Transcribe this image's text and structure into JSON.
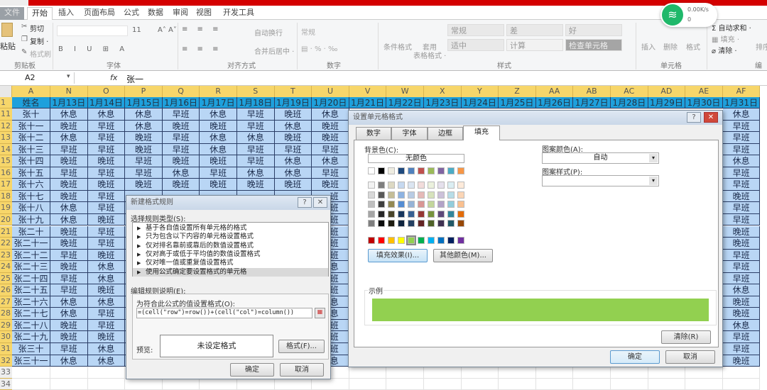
{
  "ribbon": {
    "tabs": [
      "文件",
      "开始",
      "插入",
      "页面布局",
      "公式",
      "数据",
      "审阅",
      "视图",
      "开发工具"
    ],
    "clipboard": {
      "paste": "粘贴",
      "cut": "剪切",
      "copy": "复制 ·",
      "format_painter": "格式刷",
      "group": "剪贴板"
    },
    "font": {
      "size": "11",
      "group": "字体"
    },
    "alignment": {
      "wrap": "自动换行",
      "merge": "合并后居中 ·",
      "group": "对齐方式"
    },
    "number": {
      "format": "常规",
      "group": "数字"
    },
    "styles": {
      "conditional": "条件格式",
      "table1": "套用",
      "table2": "表格格式 ·",
      "boxes": [
        "常规",
        "差",
        "好",
        "适中",
        "计算",
        "检查单元格"
      ],
      "group": "样式"
    },
    "cells": {
      "insert": "插入",
      "delete": "删除",
      "format": "格式",
      "group": "单元格"
    },
    "editing": {
      "autosum": "自动求和 ·",
      "fill": "填充 ·",
      "clear": "清除 ·",
      "sort": "排序",
      "group": "编"
    }
  },
  "network_widget": {
    "speed": "0.00K/s",
    "count": "0",
    "icon": "wifi-icon"
  },
  "formula_bar": {
    "name_box": "A2",
    "fx": "fx",
    "value": "张一"
  },
  "sheet": {
    "columns": [
      "A",
      "N",
      "O",
      "P",
      "Q",
      "R",
      "S",
      "T",
      "U",
      "V",
      "W",
      "X",
      "Y",
      "Z",
      "AA",
      "AB",
      "AC",
      "AD",
      "AE",
      "AF"
    ],
    "header_row": {
      "num": "1",
      "values": [
        "姓名",
        "1月13日",
        "1月14日",
        "1月15日",
        "1月16日",
        "1月17日",
        "1月18日",
        "1月19日",
        "1月20日",
        "1月21日",
        "1月22日",
        "1月23日",
        "1月24日",
        "1月25日",
        "1月26日",
        "1月27日",
        "1月28日",
        "1月29日",
        "1月30日",
        "1月31日"
      ]
    },
    "rows": [
      {
        "num": "11",
        "A": "张十",
        "N": "休息",
        "O": "休息",
        "P": "休息",
        "Q": "早班",
        "R": "休息",
        "S": "早班",
        "T": "晚班",
        "U": "休息",
        "AF": "休息"
      },
      {
        "num": "12",
        "A": "张十一",
        "N": "晚班",
        "O": "早班",
        "P": "休息",
        "Q": "晚班",
        "R": "晚班",
        "S": "早班",
        "T": "休息",
        "U": "晚班",
        "AF": "早班"
      },
      {
        "num": "13",
        "A": "张十二",
        "N": "休息",
        "O": "早班",
        "P": "晚班",
        "Q": "早班",
        "R": "休息",
        "S": "休息",
        "T": "晚班",
        "U": "晚班",
        "AF": "早班"
      },
      {
        "num": "14",
        "A": "张十三",
        "N": "早班",
        "O": "早班",
        "P": "晚班",
        "Q": "早班",
        "R": "休息",
        "S": "早班",
        "T": "早班",
        "U": "早班",
        "AF": "早班"
      },
      {
        "num": "15",
        "A": "张十四",
        "N": "晚班",
        "O": "晚班",
        "P": "早班",
        "Q": "晚班",
        "R": "晚班",
        "S": "早班",
        "T": "休息",
        "U": "休息",
        "AF": "休息"
      },
      {
        "num": "16",
        "A": "张十五",
        "N": "早班",
        "O": "早班",
        "P": "早班",
        "Q": "休息",
        "R": "早班",
        "S": "休息",
        "T": "休息",
        "U": "早班",
        "AF": "早班"
      },
      {
        "num": "17",
        "A": "张十六",
        "N": "晚班",
        "O": "晚班",
        "P": "晚班",
        "Q": "晚班",
        "R": "晚班",
        "S": "晚班",
        "T": "晚班",
        "U": "晚班",
        "AF": "早班"
      },
      {
        "num": "18",
        "A": "张十七",
        "N": "晚班",
        "O": "早班",
        "U": "班",
        "AF": "晚班"
      },
      {
        "num": "19",
        "A": "张十八",
        "N": "休息",
        "O": "早班",
        "U": "班",
        "AF": "早班"
      },
      {
        "num": "20",
        "A": "张十九",
        "N": "休息",
        "O": "晚班",
        "U": "班",
        "AF": "早班"
      },
      {
        "num": "21",
        "A": "张二十",
        "N": "晚班",
        "O": "早班",
        "U": "班",
        "AF": "晚班"
      },
      {
        "num": "22",
        "A": "张二十一",
        "N": "晚班",
        "O": "早班",
        "U": "班",
        "AF": "晚班"
      },
      {
        "num": "23",
        "A": "张二十二",
        "N": "早班",
        "O": "晚班",
        "U": "班",
        "AF": "早班"
      },
      {
        "num": "24",
        "A": "张二十三",
        "N": "晚班",
        "O": "休息",
        "U": "息",
        "AF": "早班"
      },
      {
        "num": "25",
        "A": "张二十四",
        "N": "早班",
        "O": "休息",
        "U": "班",
        "AF": "早班"
      },
      {
        "num": "26",
        "A": "张二十五",
        "N": "早班",
        "O": "晚班",
        "U": "班",
        "AF": "休息"
      },
      {
        "num": "27",
        "A": "张二十六",
        "N": "休息",
        "O": "休息",
        "U": "息",
        "AF": "晚班"
      },
      {
        "num": "28",
        "A": "张二十七",
        "N": "休息",
        "O": "早班",
        "U": "息",
        "AF": "晚班"
      },
      {
        "num": "29",
        "A": "张二十八",
        "N": "晚班",
        "O": "早班",
        "U": "班",
        "AF": "休息"
      },
      {
        "num": "30",
        "A": "张二十九",
        "N": "晚班",
        "O": "晚班",
        "U": "班",
        "AF": "早班"
      },
      {
        "num": "31",
        "A": "张三十",
        "N": "早班",
        "O": "休息",
        "U": "班",
        "AF": "早班"
      },
      {
        "num": "32",
        "A": "张三十一",
        "N": "休息",
        "O": "休息",
        "U": "息",
        "AF": "晚班"
      }
    ],
    "empty_rows": [
      "33",
      "34"
    ],
    "colors": {
      "header_fill": "#1ea0dc",
      "cell_fill": "#b9d6f5",
      "col_header": "#f7d66a"
    }
  },
  "rule_dialog": {
    "title": "新建格式规则",
    "help": "?",
    "close": "✕",
    "select_label": "选择规则类型(S):",
    "rule_types": [
      "基于各自值设置所有单元格的格式",
      "只为包含以下内容的单元格设置格式",
      "仅对排名靠前或靠后的数值设置格式",
      "仅对高于或低于平均值的数值设置格式",
      "仅对唯一值或重复值设置格式",
      "使用公式确定要设置格式的单元格"
    ],
    "selected_index": 5,
    "edit_label": "编辑规则说明(E):",
    "formula_label": "为符合此公式的值设置格式(O):",
    "formula": "=(cell(\"row\")=row())+(cell(\"col\")=column())",
    "preview_label": "预览:",
    "preview_text": "未设定格式",
    "format_button": "格式(F)...",
    "ok": "确定",
    "cancel": "取消"
  },
  "format_dialog": {
    "title": "设置单元格格式",
    "help": "?",
    "close": "✕",
    "tabs": [
      "数字",
      "字体",
      "边框",
      "填充"
    ],
    "active_tab": "填充",
    "bg_label": "背景色(C):",
    "no_color": "无颜色",
    "theme_colors": [
      "#FFFFFF",
      "#000000",
      "#EEECE1",
      "#1F497D",
      "#4F81BD",
      "#C0504D",
      "#9BBB59",
      "#8064A2",
      "#4BACC6",
      "#F79646"
    ],
    "tints": [
      [
        "#F2F2F2",
        "#7F7F7F",
        "#DDD9C3",
        "#C6D9F0",
        "#DBE5F1",
        "#F2DCDB",
        "#EBF1DD",
        "#E5E0EC",
        "#DBEEF3",
        "#FDEADA"
      ],
      [
        "#D8D8D8",
        "#595959",
        "#C4BD97",
        "#8DB3E2",
        "#B8CCE4",
        "#E5B9B7",
        "#D7E3BC",
        "#CCC1D9",
        "#B7DDE8",
        "#FBD5B5"
      ],
      [
        "#BFBFBF",
        "#3F3F3F",
        "#938953",
        "#548DD4",
        "#95B3D7",
        "#D99694",
        "#C3D69B",
        "#B2A2C7",
        "#92CDDC",
        "#FAC08F"
      ],
      [
        "#A5A5A5",
        "#262626",
        "#494429",
        "#17365D",
        "#366092",
        "#953734",
        "#76923C",
        "#5F497A",
        "#31859B",
        "#E36C09"
      ],
      [
        "#7F7F7F",
        "#0C0C0C",
        "#1D1B10",
        "#0F243E",
        "#244061",
        "#632423",
        "#4F6128",
        "#3F3151",
        "#205867",
        "#974806"
      ]
    ],
    "standard_colors": [
      "#C00000",
      "#FF0000",
      "#FFC000",
      "#FFFF00",
      "#92D050",
      "#00B050",
      "#00B0F0",
      "#0070C0",
      "#002060",
      "#7030A0"
    ],
    "selected_color": "#92D050",
    "fill_effects": "填充效果(I)...",
    "more_colors": "其他颜色(M)...",
    "pattern_color_label": "图案颜色(A):",
    "pattern_color": "自动",
    "pattern_style_label": "图案样式(P):",
    "sample_label": "示例",
    "clear": "清除(R)",
    "ok": "确定",
    "cancel": "取消"
  }
}
